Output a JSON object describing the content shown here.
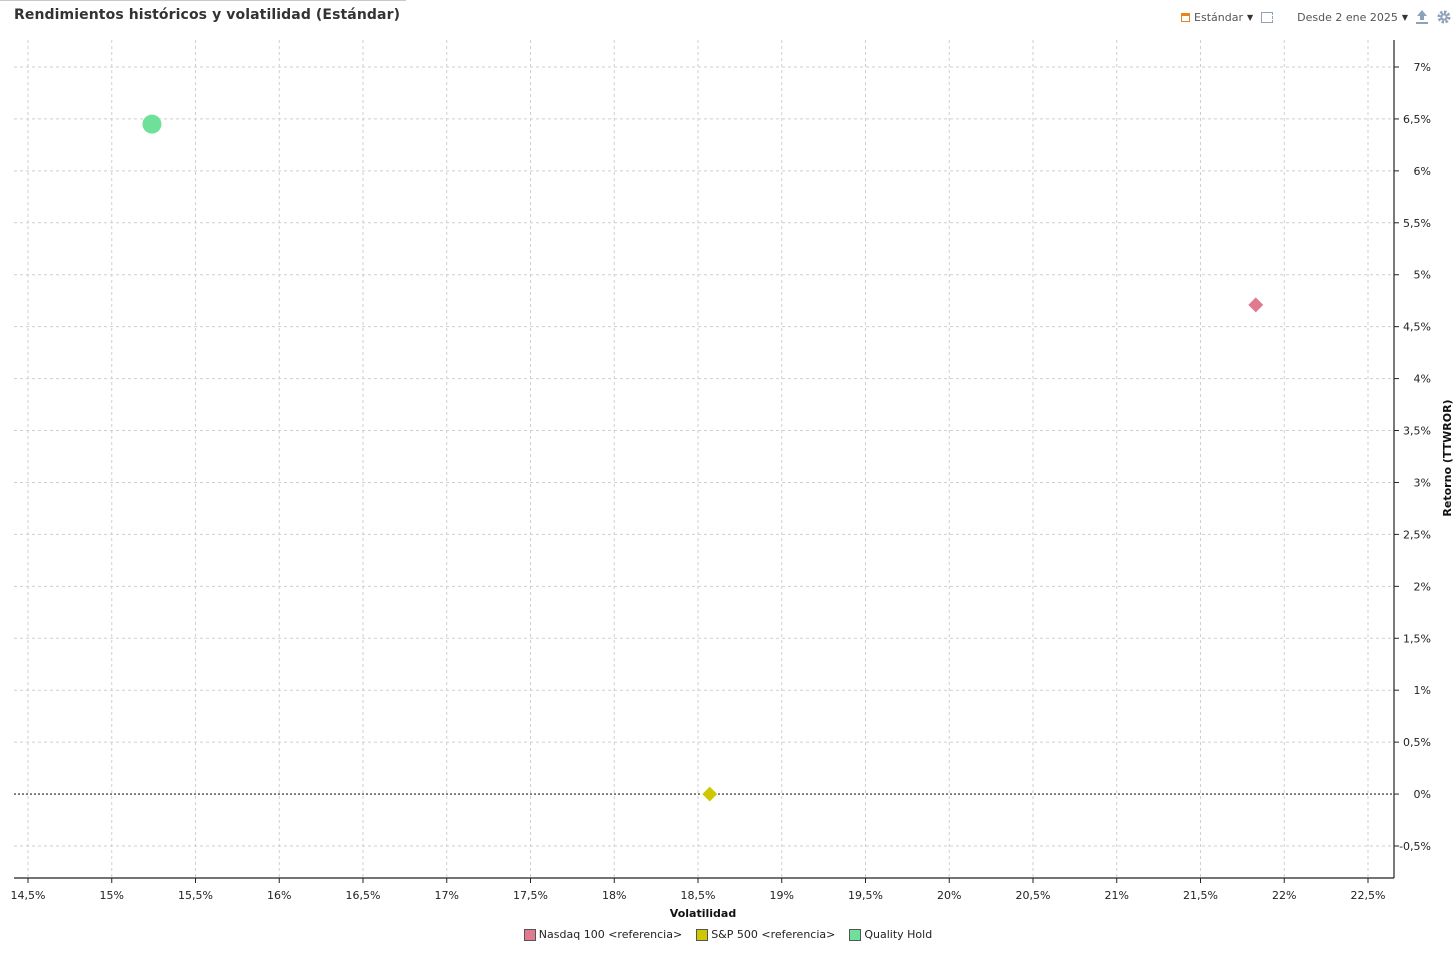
{
  "header": {
    "title": "Rendimientos históricos y volatilidad (Estándar)",
    "view_label": "Estándar",
    "period_label": "Desde 2 ene 2025"
  },
  "icons": {
    "calendar": "calendar-icon",
    "window": "window-icon",
    "export": "export-icon",
    "settings": "gear-icon"
  },
  "colors": {
    "nasdaq": "#e07a8e",
    "sp500": "#cdc800",
    "quality": "#6fe09a",
    "grid": "#cfcfcf",
    "zero_line": "#222222"
  },
  "chart_data": {
    "type": "scatter",
    "title": "Rendimientos históricos y volatilidad (Estándar)",
    "xlabel": "Volatilidad",
    "ylabel": "Retorno (TTWROR)",
    "xlim": [
      14.5,
      22.5
    ],
    "ylim": [
      -0.5,
      7
    ],
    "x_ticks": [
      "14,5%",
      "15%",
      "15,5%",
      "16%",
      "16,5%",
      "17%",
      "17,5%",
      "18%",
      "18,5%",
      "19%",
      "19,5%",
      "20%",
      "20,5%",
      "21%",
      "21,5%",
      "22%",
      "22,5%"
    ],
    "y_ticks": [
      "7%",
      "6,5%",
      "6%",
      "5,5%",
      "5%",
      "4,5%",
      "4%",
      "3,5%",
      "3%",
      "2,5%",
      "2%",
      "1,5%",
      "1%",
      "0,5%",
      "0%",
      "-0,5%"
    ],
    "grid": true,
    "legend_position": "bottom-center",
    "y_axis_position": "right",
    "series": [
      {
        "name": "Nasdaq 100 <referencia>",
        "marker": "diamond",
        "color": "#e07a8e",
        "x": 21.83,
        "y": 4.71
      },
      {
        "name": "S&P 500 <referencia>",
        "marker": "diamond",
        "color": "#cdc800",
        "x": 18.57,
        "y": 0.0
      },
      {
        "name": "Quality Hold",
        "marker": "circle",
        "color": "#6fe09a",
        "x": 15.24,
        "y": 6.45
      }
    ]
  }
}
